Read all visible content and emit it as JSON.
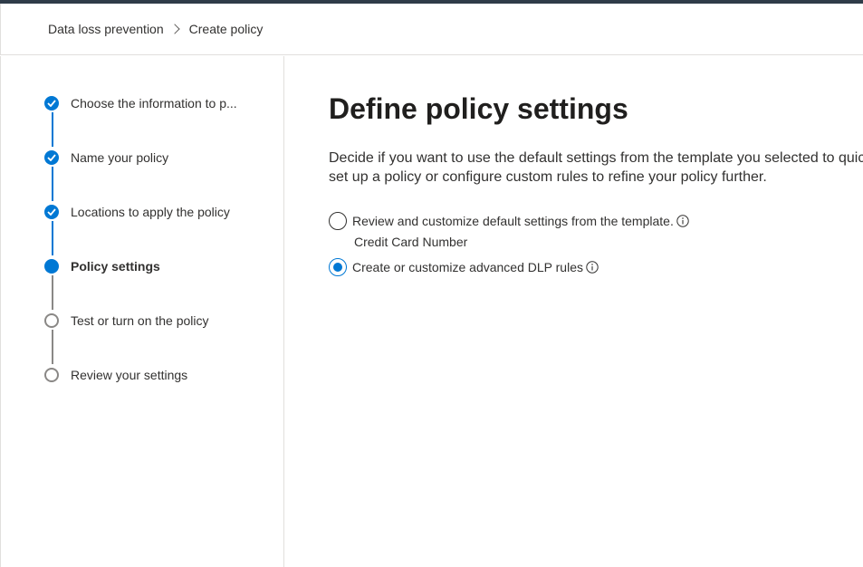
{
  "breadcrumb": {
    "items": [
      "Data loss prevention",
      "Create policy"
    ]
  },
  "steps": [
    {
      "label": "Choose the information to p...",
      "state": "done"
    },
    {
      "label": "Name your policy",
      "state": "done"
    },
    {
      "label": "Locations to apply the policy",
      "state": "done"
    },
    {
      "label": "Policy settings",
      "state": "current"
    },
    {
      "label": "Test or turn on the policy",
      "state": "todo"
    },
    {
      "label": "Review your settings",
      "state": "todo"
    }
  ],
  "main": {
    "title": "Define policy settings",
    "description": "Decide if you want to use the default settings from the template you selected to quickly set up a policy or configure custom rules to refine your policy further.",
    "options": [
      {
        "label": "Review and customize default settings from the template.",
        "checked": false,
        "sub_label": "Credit Card Number"
      },
      {
        "label": "Create or customize advanced DLP rules",
        "checked": true
      }
    ]
  },
  "colors": {
    "accent": "#0078d4",
    "topbar": "#2f3c49"
  }
}
